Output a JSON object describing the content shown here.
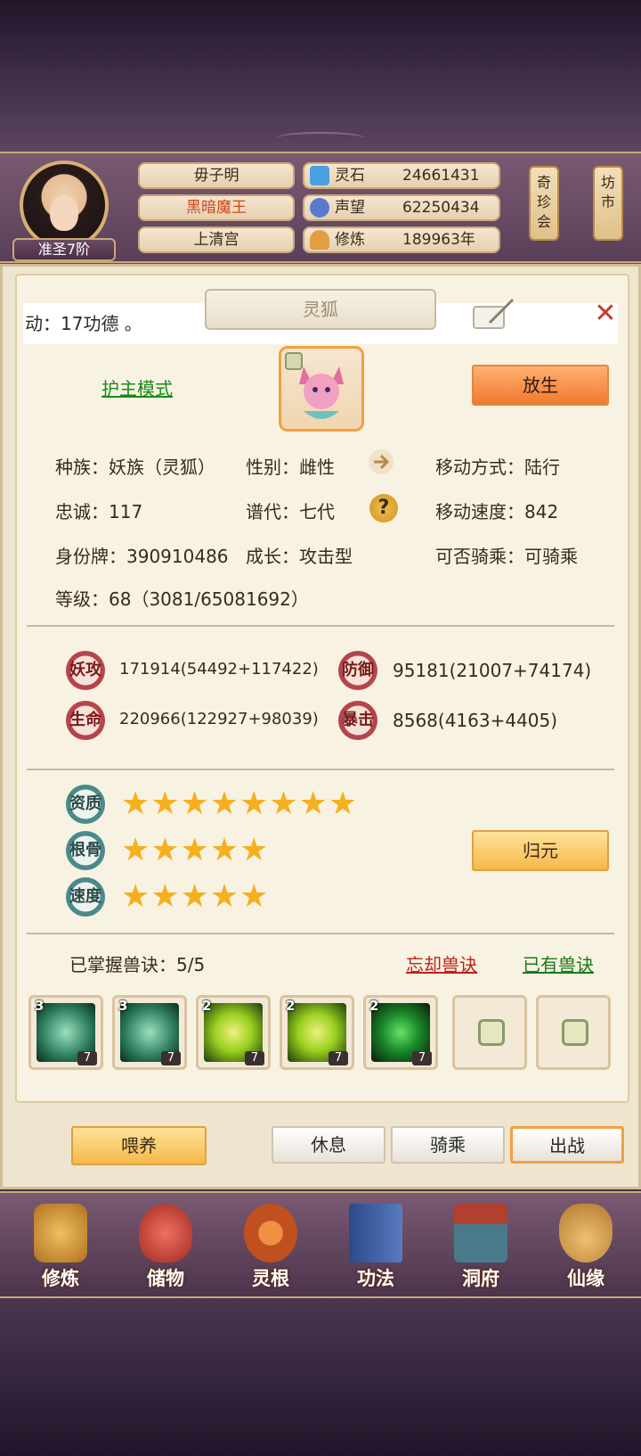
{
  "header": {
    "rank": "准圣7阶",
    "player_name": "毋子明",
    "title": "黑暗魔王",
    "sect": "上清宫",
    "stats": [
      {
        "label": "灵石",
        "value": "24661431",
        "icon": "spirit-stone-icon",
        "color": "#4aa0e0"
      },
      {
        "label": "声望",
        "value": "62250434",
        "icon": "prestige-icon",
        "color": "#5a7ad0"
      },
      {
        "label": "修炼",
        "value": "189963年",
        "icon": "meditation-icon",
        "color": "#e0a040"
      }
    ],
    "side_buttons": [
      "奇珍会",
      "坊市"
    ]
  },
  "panel": {
    "title": "灵狐",
    "marquee": "动：17功德 。",
    "mode_link": "护主模式",
    "release_button": "放生",
    "info": {
      "race": "种族：妖族（灵狐）",
      "gender": "性别：雌性",
      "move_type": "移动方式：陆行",
      "loyalty": "忠诚：117",
      "generation": "谱代：七代",
      "move_speed": "移动速度：842",
      "id_tag": "身份牌：390910486",
      "growth": "成长：攻击型",
      "rideable": "可否骑乘：可骑乘",
      "level": "等级：68（3081/65081692）"
    },
    "attrs": [
      {
        "badge": "妖攻",
        "value": "171914(54492+117422)"
      },
      {
        "badge": "防御",
        "value": "95181(21007+74174)"
      },
      {
        "badge": "生命",
        "value": "220966(122927+98039)"
      },
      {
        "badge": "暴击",
        "value": "8568(4163+4405)"
      }
    ],
    "talents": [
      {
        "badge": "资质",
        "stars": 8,
        "star_text": "★★★★★★★★"
      },
      {
        "badge": "根骨",
        "stars": 5,
        "star_text": "★★★★★"
      },
      {
        "badge": "速度",
        "stars": 5,
        "star_text": "★★★★★"
      }
    ],
    "reset_button": "归元",
    "skills_mastered": "已掌握兽诀：5/5",
    "forget_link": "忘却兽诀",
    "owned_link": "已有兽诀",
    "skills": [
      {
        "tier": "3",
        "count": "7",
        "color": "#2a7a5a"
      },
      {
        "tier": "3",
        "count": "7",
        "color": "#2a7a5a"
      },
      {
        "tier": "2",
        "count": "7",
        "color": "#9ad020"
      },
      {
        "tier": "2",
        "count": "7",
        "color": "#9ad020"
      },
      {
        "tier": "2",
        "count": "7",
        "color": "#1a8a2a"
      }
    ],
    "buttons": {
      "feed": "喂养",
      "rest": "休息",
      "ride": "骑乘",
      "battle": "出战"
    }
  },
  "nav": [
    {
      "label": "修炼",
      "icon": "meditate-icon",
      "color": "#d4a040"
    },
    {
      "label": "储物",
      "icon": "storage-bag-icon",
      "color": "#d04a40"
    },
    {
      "label": "灵根",
      "icon": "spirit-root-icon",
      "color": "#c06030"
    },
    {
      "label": "功法",
      "icon": "scripture-book-icon",
      "color": "#4a6ab0"
    },
    {
      "label": "洞府",
      "icon": "cave-house-icon",
      "color": "#5a8aa0"
    },
    {
      "label": "仙缘",
      "icon": "gourd-icon",
      "color": "#d0a050"
    }
  ]
}
